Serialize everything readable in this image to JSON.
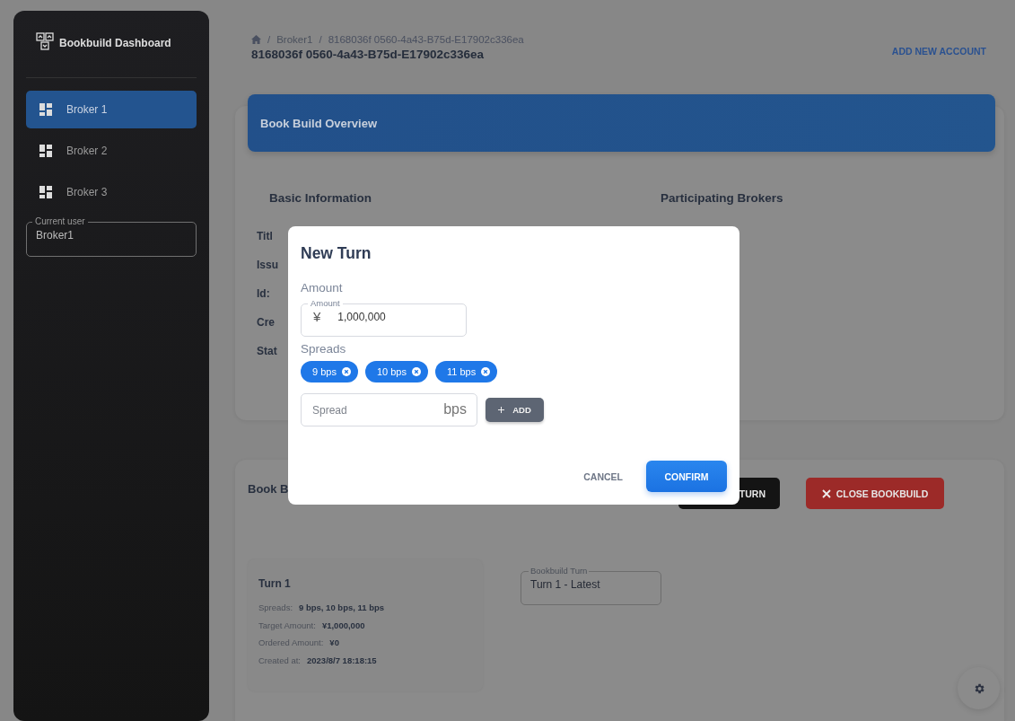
{
  "sidebar": {
    "brand": "Bookbuild Dashboard",
    "items": [
      {
        "label": "Broker 1",
        "selected": true
      },
      {
        "label": "Broker 2",
        "selected": false
      },
      {
        "label": "Broker 3",
        "selected": false
      }
    ],
    "current_user": {
      "label": "Current user",
      "value": "Broker1"
    }
  },
  "header": {
    "separator": "/",
    "breadcrumb": [
      "Broker1",
      "8168036f 0560-4a43-B75d-E17902c336ea"
    ],
    "title": "8168036f 0560-4a43-B75d-E17902c336ea",
    "action": "ADD NEW ACCOUNT"
  },
  "overview": {
    "header": "Book Build Overview",
    "basic_title": "Basic Information",
    "fields": [
      "Titl",
      "Issu",
      "Id:",
      "Cre",
      "Stat"
    ],
    "brokers_title": "Participating Brokers"
  },
  "bookbuild": {
    "title": "Book B",
    "buttons": [
      {
        "label": "TURN",
        "kind": "dark"
      },
      {
        "label": "CLOSE BOOKBUILD",
        "kind": "danger"
      }
    ],
    "turn_card": {
      "title": "Turn 1",
      "rows": [
        {
          "label": "Spreads:",
          "value": "9 bps, 10 bps, 11 bps"
        },
        {
          "label": "Target Amount:",
          "value": "¥1,000,000"
        },
        {
          "label": "Ordered Amount:",
          "value": "¥0"
        },
        {
          "label": "Created at:",
          "value": "2023/8/7 18:18:15"
        }
      ]
    },
    "turn_select": {
      "label": "Bookbuild Turn",
      "value": "Turn 1 - Latest"
    }
  },
  "dialog": {
    "title": "New Turn",
    "amount_label": "Amount",
    "amount_field": {
      "label": "Amount",
      "prefix": "¥",
      "value": "1,000,000"
    },
    "spreads_label": "Spreads",
    "chips": [
      "9 bps",
      "10 bps",
      "11 bps"
    ],
    "spread_field": {
      "placeholder": "Spread",
      "suffix": "bps"
    },
    "add_button": "ADD",
    "cancel": "CANCEL",
    "confirm": "CONFIRM"
  }
}
